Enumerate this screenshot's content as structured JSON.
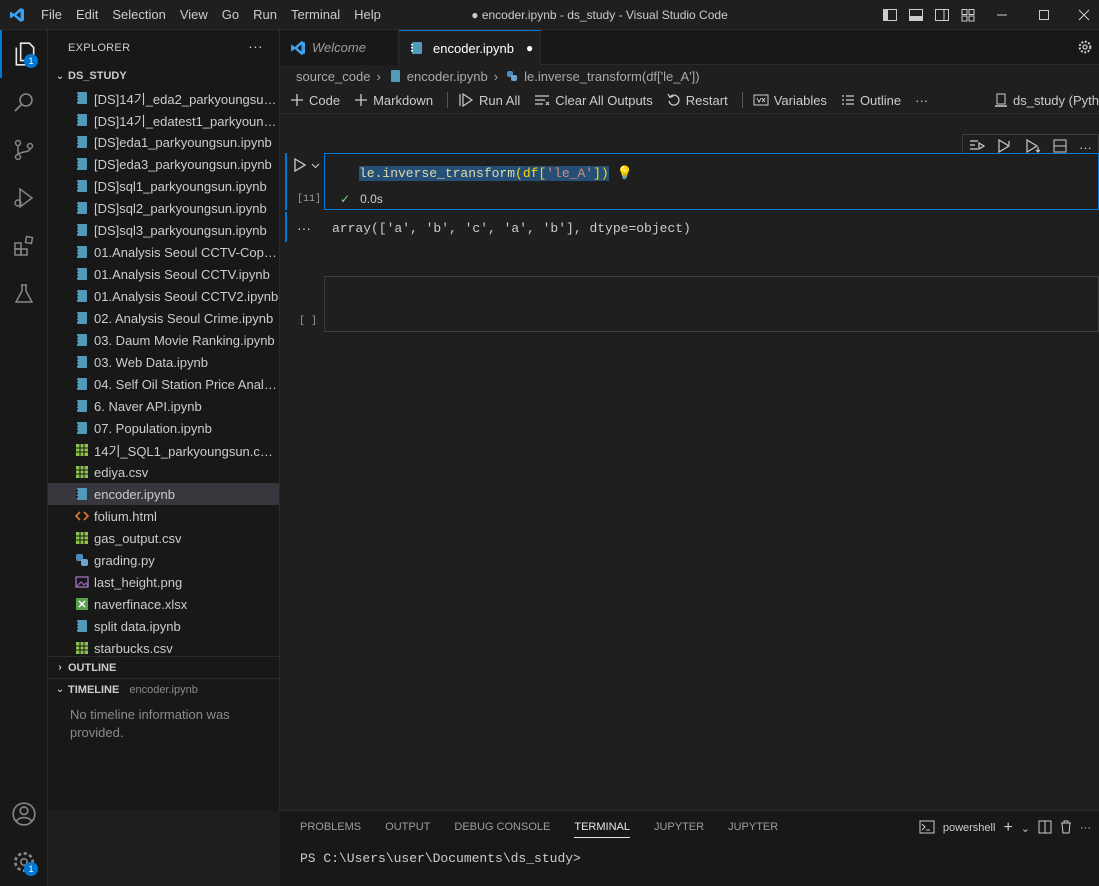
{
  "menu": [
    "File",
    "Edit",
    "Selection",
    "View",
    "Go",
    "Run",
    "Terminal",
    "Help"
  ],
  "menu_underline": [
    "F",
    "E",
    "S",
    "V",
    "G",
    "R",
    "T",
    "H"
  ],
  "window_title": "● encoder.ipynb - ds_study - Visual Studio Code",
  "activity": {
    "explorer_badge": "1",
    "settings_badge": "1"
  },
  "sidebar": {
    "header": "EXPLORER",
    "more": "···",
    "folder": "DS_STUDY",
    "files": [
      {
        "name": "[DS]14기_eda2_parkyoungsun.i...",
        "type": "notebook"
      },
      {
        "name": "[DS]14기_edatest1_parkyoungs...",
        "type": "notebook"
      },
      {
        "name": "[DS]eda1_parkyoungsun.ipynb",
        "type": "notebook"
      },
      {
        "name": "[DS]eda3_parkyoungsun.ipynb",
        "type": "notebook"
      },
      {
        "name": "[DS]sql1_parkyoungsun.ipynb",
        "type": "notebook"
      },
      {
        "name": "[DS]sql2_parkyoungsun.ipynb",
        "type": "notebook"
      },
      {
        "name": "[DS]sql3_parkyoungsun.ipynb",
        "type": "notebook"
      },
      {
        "name": "01.Analysis Seoul CCTV-Copy1....",
        "type": "notebook"
      },
      {
        "name": "01.Analysis Seoul CCTV.ipynb",
        "type": "notebook"
      },
      {
        "name": "01.Analysis Seoul CCTV2.ipynb",
        "type": "notebook"
      },
      {
        "name": "02. Analysis Seoul Crime.ipynb",
        "type": "notebook"
      },
      {
        "name": "03. Daum Movie Ranking.ipynb",
        "type": "notebook"
      },
      {
        "name": "03. Web Data.ipynb",
        "type": "notebook"
      },
      {
        "name": "04. Self Oil Station Price Analys...",
        "type": "notebook"
      },
      {
        "name": "6. Naver API.ipynb",
        "type": "notebook"
      },
      {
        "name": "07. Population.ipynb",
        "type": "notebook"
      },
      {
        "name": "14기_SQL1_parkyoungsun.csv.c...",
        "type": "csv"
      },
      {
        "name": "ediya.csv",
        "type": "csv"
      },
      {
        "name": "encoder.ipynb",
        "type": "notebook",
        "active": true
      },
      {
        "name": "folium.html",
        "type": "html"
      },
      {
        "name": "gas_output.csv",
        "type": "csv"
      },
      {
        "name": "grading.py",
        "type": "python"
      },
      {
        "name": "last_height.png",
        "type": "image"
      },
      {
        "name": "naverfinace.xlsx",
        "type": "excel"
      },
      {
        "name": "split data.ipynb",
        "type": "notebook"
      },
      {
        "name": "starbucks.csv",
        "type": "csv"
      }
    ],
    "outline": "OUTLINE",
    "timeline": "TIMELINE",
    "timeline_file": "encoder.ipynb",
    "timeline_msg": "No timeline information was provided."
  },
  "tabs": [
    {
      "label": "Welcome"
    },
    {
      "label": "encoder.ipynb",
      "dirty": "●"
    }
  ],
  "breadcrumb": [
    "source_code",
    "encoder.ipynb",
    "le.inverse_transform(df['le_A'])"
  ],
  "toolbar": {
    "code": "Code",
    "markdown": "Markdown",
    "run_all": "Run All",
    "clear": "Clear All Outputs",
    "restart": "Restart",
    "variables": "Variables",
    "outline": "Outline",
    "more": "···",
    "kernel": "ds_study (Pyth"
  },
  "cell1": {
    "code_fn": "le.inverse_transform",
    "code_open": "(df[",
    "code_str": "'le_A'",
    "code_close": "])",
    "exec_count": "[11]",
    "duration": "0.0s",
    "output": "array(['a', 'b', 'c', 'a', 'b'], dtype=object)",
    "output_dots": "···"
  },
  "cell2": {
    "exec_count": "[ ]"
  },
  "panel": {
    "tabs": [
      "PROBLEMS",
      "OUTPUT",
      "DEBUG CONSOLE",
      "TERMINAL",
      "JUPYTER",
      "JUPYTER"
    ],
    "active_tab": "TERMINAL",
    "shell": "powershell",
    "prompt": "PS C:\\Users\\user\\Documents\\ds_study>"
  },
  "colors": {
    "accent": "#0078d4",
    "selection": "#264f78",
    "csv_icon": "#8bc34a",
    "notebook_icon": "#519aba"
  }
}
